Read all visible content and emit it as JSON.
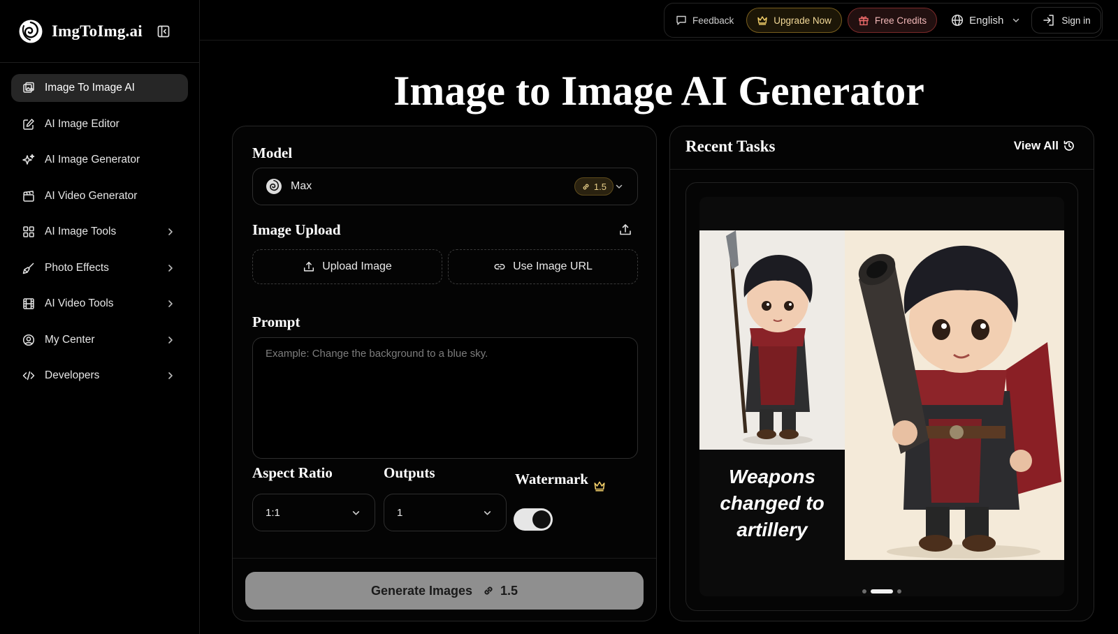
{
  "brand": {
    "name": "ImgToImg.ai"
  },
  "sidebar": {
    "items": [
      {
        "label": "Image To Image AI",
        "icon": "image-edit-icon",
        "active": true,
        "has_submenu": false
      },
      {
        "label": "AI Image Editor",
        "icon": "pencil-square-icon",
        "active": false,
        "has_submenu": false
      },
      {
        "label": "AI Image Generator",
        "icon": "sparkles-icon",
        "active": false,
        "has_submenu": false
      },
      {
        "label": "AI Video Generator",
        "icon": "clapperboard-icon",
        "active": false,
        "has_submenu": false
      },
      {
        "label": "AI Image Tools",
        "icon": "grid-icon",
        "active": false,
        "has_submenu": true
      },
      {
        "label": "Photo Effects",
        "icon": "brush-icon",
        "active": false,
        "has_submenu": true
      },
      {
        "label": "AI Video Tools",
        "icon": "film-icon",
        "active": false,
        "has_submenu": true
      },
      {
        "label": "My Center",
        "icon": "user-circle-icon",
        "active": false,
        "has_submenu": true
      },
      {
        "label": "Developers",
        "icon": "code-icon",
        "active": false,
        "has_submenu": true
      }
    ]
  },
  "topbar": {
    "feedback": "Feedback",
    "upgrade": "Upgrade Now",
    "free_credits": "Free Credits",
    "language": "English",
    "sign_in": "Sign in"
  },
  "page": {
    "title": "Image to Image AI Generator"
  },
  "form": {
    "model_label": "Model",
    "model_value": "Max",
    "model_cost": "1.5",
    "image_upload_label": "Image Upload",
    "upload_button": "Upload Image",
    "url_button": "Use Image URL",
    "prompt_label": "Prompt",
    "prompt_value": "",
    "prompt_placeholder": "Example: Change the background to a blue sky.",
    "aspect_ratio_label": "Aspect Ratio",
    "aspect_ratio_value": "1:1",
    "outputs_label": "Outputs",
    "outputs_value": "1",
    "watermark_label": "Watermark",
    "watermark_on": true,
    "generate_label": "Generate Images",
    "generate_cost": "1.5"
  },
  "recent_tasks": {
    "title": "Recent Tasks",
    "view_all": "View All",
    "slide_caption": "Weapons changed to artillery",
    "slides": 3,
    "active_slide": 2
  },
  "colors": {
    "background": "#000000",
    "upgrade_accent": "#f3d998",
    "credits_accent": "#f3b9b9",
    "generate_button": "#8f8f8f"
  }
}
